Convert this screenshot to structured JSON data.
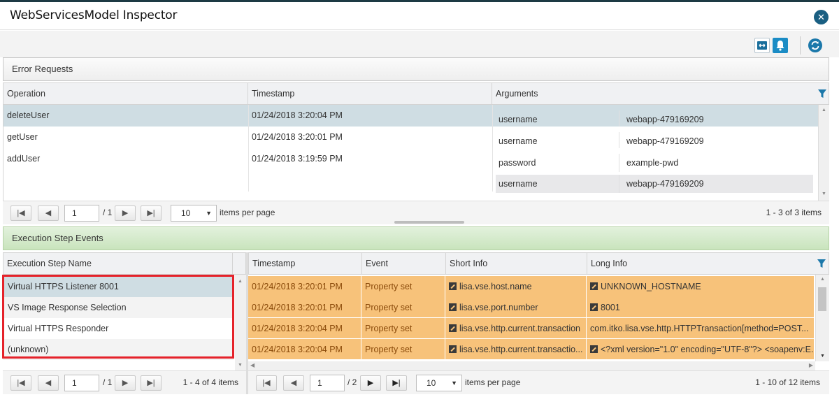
{
  "window": {
    "title": "WebServicesModel Inspector",
    "close_icon": "close-icon"
  },
  "toolbar": {
    "icons": [
      "expand-icon",
      "alert-icon",
      "refresh-icon"
    ]
  },
  "error_requests": {
    "title": "Error Requests",
    "columns": [
      "Operation",
      "Timestamp",
      "Arguments"
    ],
    "rows": [
      {
        "operation": "deleteUser",
        "timestamp": "01/24/2018 3:20:04 PM",
        "args": [
          {
            "name": "username",
            "value": "webapp-479169209"
          }
        ]
      },
      {
        "operation": "getUser",
        "timestamp": "01/24/2018 3:20:01 PM",
        "args": [
          {
            "name": "username",
            "value": "webapp-479169209"
          }
        ]
      },
      {
        "operation": "addUser",
        "timestamp": "01/24/2018 3:19:59 PM",
        "args": [
          {
            "name": "password",
            "value": "example-pwd"
          },
          {
            "name": "username",
            "value": "webapp-479169209"
          }
        ]
      }
    ],
    "pager": {
      "page": "1",
      "of_text": "/ 1",
      "page_size": "10",
      "items_per_page": "items per page",
      "range": "1 - 3 of 3 items"
    }
  },
  "execution_step_events": {
    "title": "Execution Step Events",
    "steps_column": "Execution Step Name",
    "steps": [
      "Virtual HTTPS Listener 8001",
      "VS Image Response Selection",
      "Virtual HTTPS Responder",
      "(unknown)"
    ],
    "steps_pager": {
      "page": "1",
      "of_text": "/ 1",
      "range": "1 - 4 of 4 items"
    },
    "columns": [
      "Timestamp",
      "Event",
      "Short Info",
      "Long Info"
    ],
    "events": [
      {
        "timestamp": "01/24/2018 3:20:01 PM",
        "event": "Property set",
        "short": "lisa.vse.host.name",
        "long": "UNKNOWN_HOSTNAME"
      },
      {
        "timestamp": "01/24/2018 3:20:01 PM",
        "event": "Property set",
        "short": "lisa.vse.port.number",
        "long": "8001"
      },
      {
        "timestamp": "01/24/2018 3:20:04 PM",
        "event": "Property set",
        "short": "lisa.vse.http.current.transaction",
        "long": "com.itko.lisa.vse.http.HTTPTransaction[method=POST..."
      },
      {
        "timestamp": "01/24/2018 3:20:04 PM",
        "event": "Property set",
        "short": "lisa.vse.http.current.transactio...",
        "long": "<?xml version=\"1.0\" encoding=\"UTF-8\"?> <soapenv:E..."
      }
    ],
    "events_pager": {
      "page": "1",
      "of_text": "/ 2",
      "page_size": "10",
      "items_per_page": "items per page",
      "range": "1 - 10 of 12 items"
    }
  },
  "colors": {
    "accent": "#1b8cc5",
    "row_selected": "#cfdde3",
    "highlight_border": "#e5222a",
    "event_row": "#f7c27a",
    "exec_header": "#c9e4bd"
  }
}
